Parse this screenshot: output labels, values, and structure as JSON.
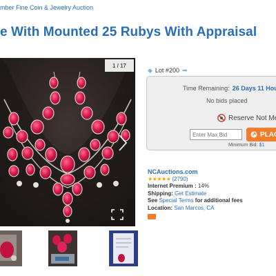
{
  "page": {
    "auction_name": "mber Fine Coin & Jewelry Auction",
    "lot_title": "e With Mounted 25 Rubys With Appraisal"
  },
  "gallery": {
    "counter": "1 / 17",
    "next_icon": "chevron-right-icon",
    "fullscreen_icon": "expand-icon",
    "thumbnail_count": 3
  },
  "lot_nav": {
    "prev_icon": "arrow-left-icon",
    "lot_number": "Lot #200",
    "next_icon": "arrow-right-icon"
  },
  "bidding": {
    "time_label": "Time Remaining:",
    "time_value": "26 Days 11 Hou",
    "bids_placed": "No bids placed",
    "reserve_text": "Reserve Not Me",
    "max_bid_placeholder": "Enter Max Bid",
    "place_bid_label": "PLAC",
    "min_bid_label": "Minimum Bid:",
    "min_bid_value": "$1"
  },
  "seller": {
    "name": "NCAuctions.com",
    "stars": "★★★★★",
    "rating_count": "(2790)",
    "premium_label": "Internet Premium :",
    "premium_value": "14%",
    "shipping_label": "Shipping:",
    "shipping_value": "Get Estimate",
    "terms_prefix": "See",
    "terms_link": "Special Terms",
    "terms_suffix": "for additional fees",
    "location_label": "Location:",
    "location_value": "San Marcos, CA"
  },
  "colors": {
    "link_blue": "#2a6db5",
    "bid_button_orange": "#f37d2a",
    "bid_box_bg": "#eeeeee"
  }
}
